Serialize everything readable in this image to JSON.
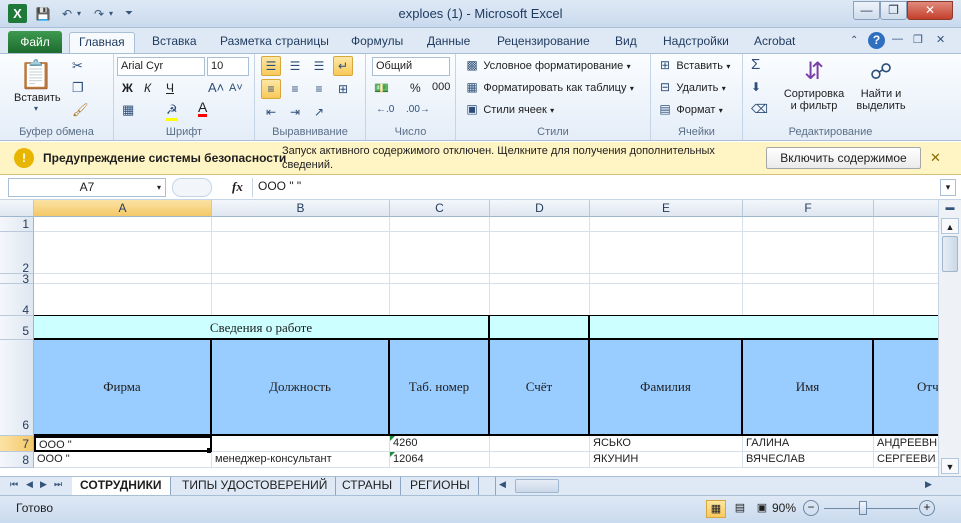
{
  "window": {
    "title": "exploes (1)  -  Microsoft Excel",
    "app_icon": "X"
  },
  "ribbon_tabs": [
    "Файл",
    "Главная",
    "Вставка",
    "Разметка страницы",
    "Формулы",
    "Данные",
    "Рецензирование",
    "Вид",
    "Надстройки",
    "Acrobat"
  ],
  "ribbon": {
    "clipboard": {
      "label": "Буфер обмена",
      "paste": "Вставить"
    },
    "font": {
      "label": "Шрифт",
      "name": "Arial Cyr",
      "size": "10",
      "bold": "Ж",
      "italic": "К",
      "underline": "Ч"
    },
    "alignment": {
      "label": "Выравнивание"
    },
    "number": {
      "label": "Число",
      "format": "Общий",
      "percent": "%",
      "thousands": "000"
    },
    "styles": {
      "label": "Стили",
      "conditional": "Условное форматирование",
      "as_table": "Форматировать как таблицу",
      "cell_styles": "Стили ячеек"
    },
    "cells": {
      "label": "Ячейки",
      "insert": "Вставить",
      "delete": "Удалить",
      "format": "Формат"
    },
    "editing": {
      "label": "Редактирование",
      "sort1": "Сортировка",
      "sort2": "и фильтр",
      "find1": "Найти и",
      "find2": "выделить"
    }
  },
  "security_bar": {
    "title": "Предупреждение системы безопасности",
    "message": "Запуск активного содержимого отключен. Щелкните для получения дополнительных сведений.",
    "button": "Включить содержимое"
  },
  "formula_bar": {
    "name_box": "A7",
    "fx": "fx",
    "value": "ООО \"                    \""
  },
  "columns": [
    "A",
    "B",
    "C",
    "D",
    "E",
    "F"
  ],
  "rows": [
    "1",
    "2",
    "3",
    "4",
    "5",
    "6",
    "7",
    "8"
  ],
  "sheet": {
    "section_title": "Сведения о работе",
    "headers": [
      "Фирма",
      "Должность",
      "Таб. номер",
      "Счёт",
      "Фамилия",
      "Имя",
      "Отч"
    ],
    "data": [
      [
        "ООО \"",
        "",
        "4260",
        "",
        "ЯСЬКО",
        "ГАЛИНА",
        "АНДРЕЕВН"
      ],
      [
        "ООО \"",
        "менеджер-консультант",
        "12064",
        "",
        "ЯКУНИН",
        "ВЯЧЕСЛАВ",
        "СЕРГЕЕВИ"
      ]
    ]
  },
  "sheet_tabs": [
    "СОТРУДНИКИ",
    "ТИПЫ УДОСТОВЕРЕНИЙ",
    "СТРАНЫ",
    "РЕГИОНЫ"
  ],
  "status": {
    "text": "Готово",
    "zoom": "90%"
  },
  "colors": {
    "header_fill": "#99ccff",
    "section_fill": "#ccffff",
    "file_tab": "#2e8b43",
    "security_bar": "#fff4c4"
  }
}
